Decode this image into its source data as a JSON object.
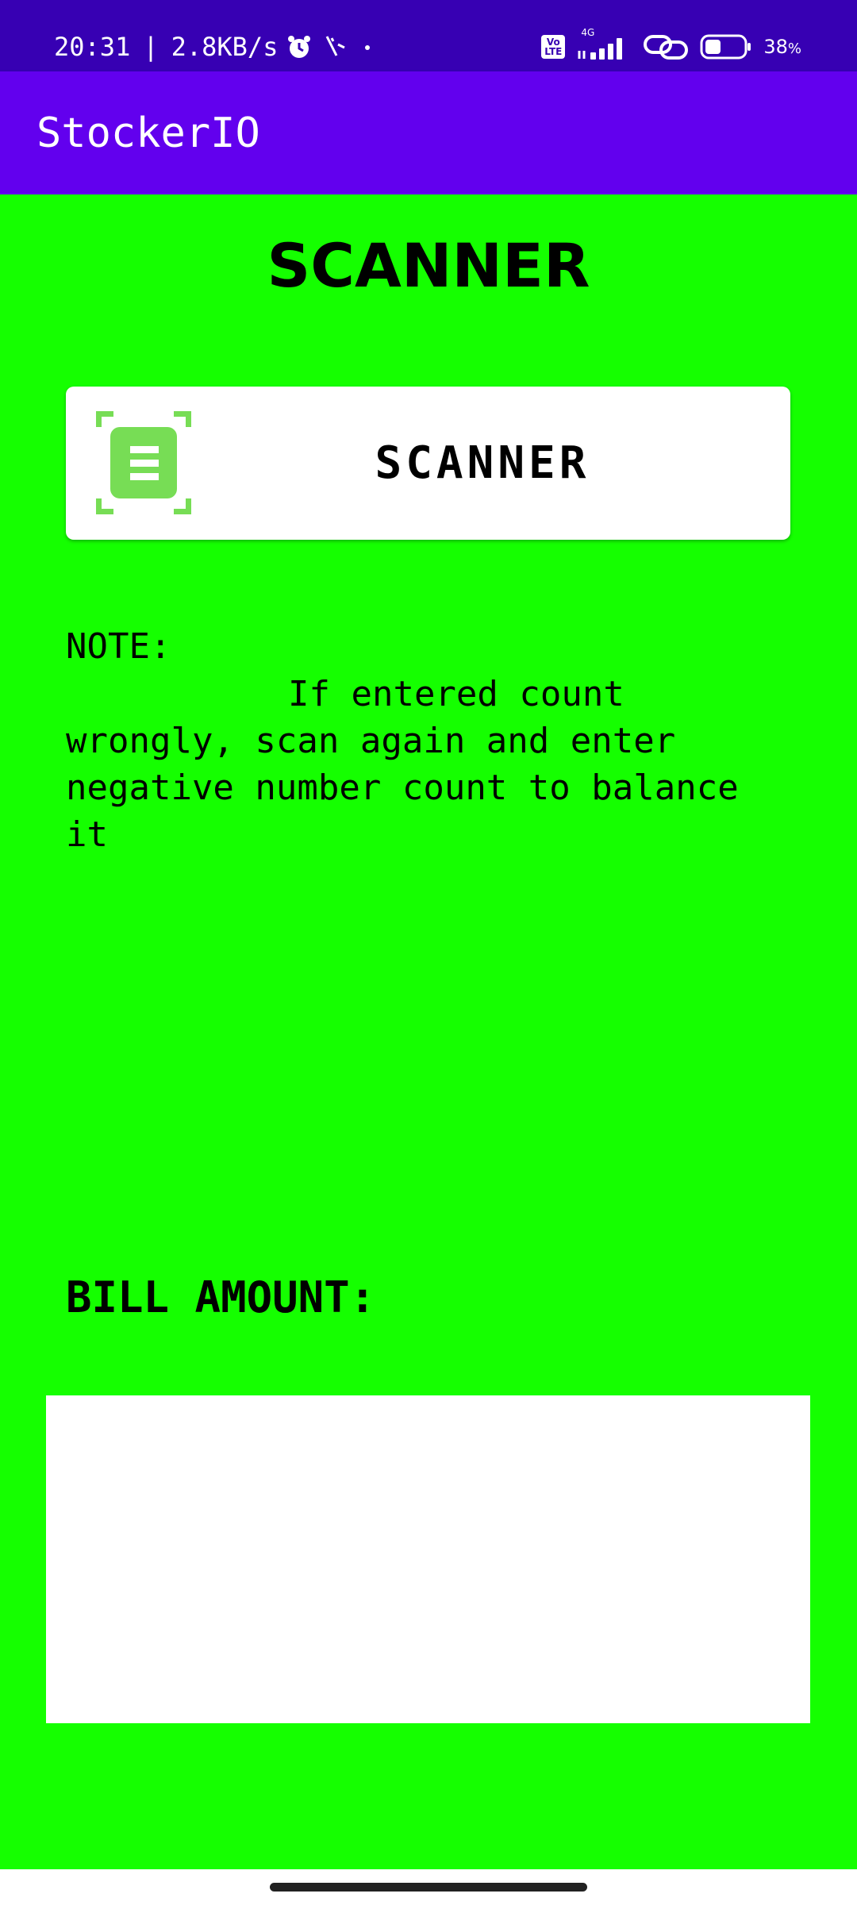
{
  "status_bar": {
    "time": "20:31",
    "separator": "|",
    "network_speed": "2.8KB/s",
    "volte_line1": "Vo",
    "volte_line2": "LTE",
    "network_type": "4G",
    "battery_percent": "38",
    "battery_unit": "%",
    "icons": [
      "alarm-icon",
      "usb-debug-icon",
      "dot-icon",
      "volte-icon",
      "signal-icon",
      "link-icon",
      "battery-icon"
    ]
  },
  "app_bar": {
    "title": "StockerIO",
    "background": "#6200ee"
  },
  "main": {
    "heading": "SCANNER",
    "scan_button_label": "SCANNER",
    "scan_icon": "document-scanner-icon",
    "note_title": "NOTE:",
    "note_body": "If entered count wrongly, scan again and enter negative number count to balance it",
    "bill_label": "BILL AMOUNT:",
    "bill_value": ""
  },
  "colors": {
    "status_bar": "#3700b3",
    "app_bar": "#6200ee",
    "content_background": "#15ff00",
    "scan_icon": "#77dd55",
    "card": "#ffffff"
  }
}
